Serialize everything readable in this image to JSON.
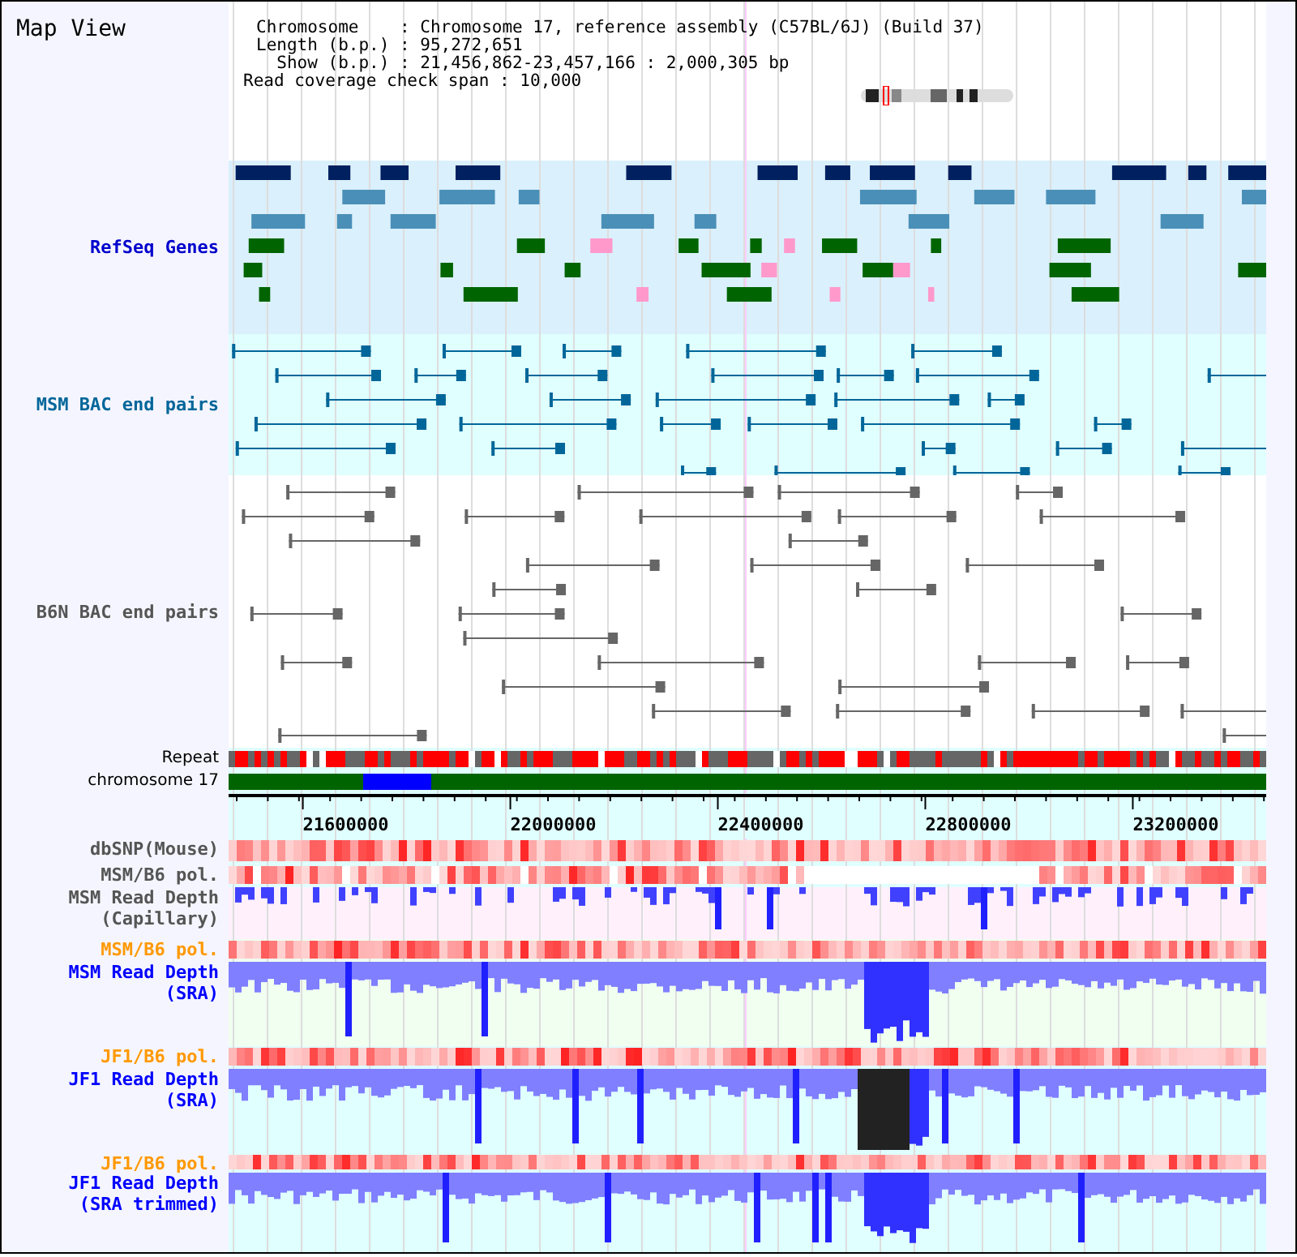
{
  "title": "Map View",
  "info": [
    "Chromosome    : Chromosome 17, reference assembly (C57BL/6J) (Build 37)",
    "Length (b.p.) : 95,272,651",
    "  Show (b.p.) : 21,456,862-23,457,166 : 2,000,305 bp",
    "Read coverage check span : 10,000"
  ],
  "tracks": [
    {
      "kind": "genes",
      "label": [
        "RefSeq Genes"
      ],
      "color": "#0000cc"
    },
    {
      "kind": "bac",
      "label": [
        "MSM BAC end pairs"
      ],
      "color": "#006699"
    },
    {
      "kind": "b6n",
      "label": [
        "B6N BAC end pairs"
      ],
      "color": "#555555"
    },
    {
      "kind": "repeat",
      "label": [
        "Repeat"
      ],
      "color": "#000000"
    },
    {
      "kind": "chromosome",
      "label": [
        "chromosome 17"
      ],
      "color": "#000000"
    },
    {
      "kind": "axis",
      "ticks": [
        "21600000",
        "22000000",
        "22400000",
        "22800000",
        "23200000"
      ]
    },
    {
      "kind": "heat",
      "label": [
        "dbSNP(Mouse)"
      ],
      "color": "#555555"
    },
    {
      "kind": "heat",
      "label": [
        "MSM/B6 pol."
      ],
      "color": "#555555"
    },
    {
      "kind": "depth",
      "label": [
        "MSM Read Depth",
        "(Capillary)"
      ],
      "color": "#555555"
    },
    {
      "kind": "heat",
      "label": [
        "MSM/B6 pol."
      ],
      "color": "#ff9900"
    },
    {
      "kind": "depth",
      "label": [
        "MSM Read Depth",
        "(SRA)"
      ],
      "color": "#0000ff"
    },
    {
      "kind": "heat",
      "label": [
        "JF1/B6 pol."
      ],
      "color": "#ff9900"
    },
    {
      "kind": "depth",
      "label": [
        "JF1 Read Depth",
        "(SRA)"
      ],
      "color": "#0000ff"
    },
    {
      "kind": "heat",
      "label": [
        "JF1/B6 pol."
      ],
      "color": "#ff9900"
    },
    {
      "kind": "depth",
      "label": [
        "JF1 Read Depth",
        "(SRA trimmed)"
      ],
      "color": "#0000ff"
    }
  ]
}
